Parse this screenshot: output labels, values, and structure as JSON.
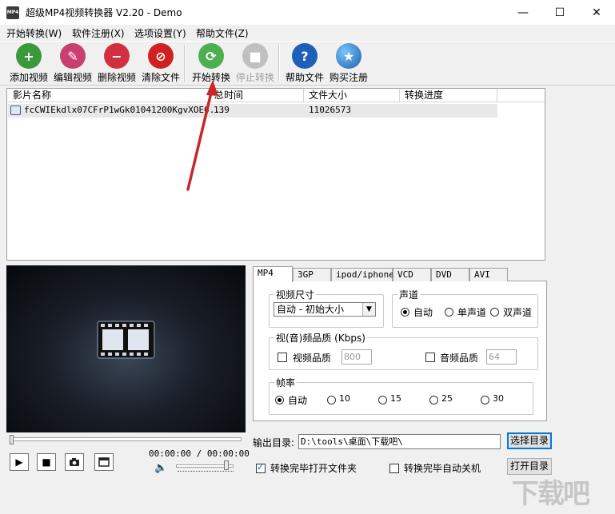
{
  "window": {
    "app_icon_text": "MP4",
    "title": "超级MP4视频转换器 V2.20 - Demo",
    "minimize": "—",
    "maximize": "☐",
    "close": "✕"
  },
  "menu": [
    "开始转换(W)",
    "软件注册(X)",
    "选项设置(Y)",
    "帮助文件(Z)"
  ],
  "toolbar": [
    {
      "label": "添加视频",
      "icon": "add-video-icon",
      "color": "#3a9a3a"
    },
    {
      "label": "编辑视频",
      "icon": "edit-video-icon",
      "color": "#c94070"
    },
    {
      "label": "删除视频",
      "icon": "delete-video-icon",
      "color": "#d03040"
    },
    {
      "label": "清除文件",
      "icon": "clear-files-icon",
      "color": "#d02020"
    },
    {
      "label": "开始转换",
      "icon": "start-convert-icon",
      "color": "#4caf50"
    },
    {
      "label": "停止转换",
      "icon": "stop-convert-icon",
      "color": "#b8b8b8",
      "disabled": true
    },
    {
      "label": "帮助文件",
      "icon": "help-icon",
      "color": "#1e5fb8"
    },
    {
      "label": "购买注册",
      "icon": "buy-register-icon",
      "color": "#2a7fd0"
    }
  ],
  "file_list": {
    "columns": [
      "影片名称",
      "总时间",
      "文件大小",
      "转换进度"
    ],
    "rows": [
      {
        "name": "fcCWIEkdlx07CFrP1wGk01041200KgvXOE0...",
        "duration": "139",
        "size": "11026573",
        "progress": ""
      }
    ]
  },
  "player": {
    "timecode": "00:00:00 / 00:00:00",
    "play": "▶",
    "stop": "■",
    "snapshot": "📷",
    "fullscreen": "▭",
    "speaker": "🔈"
  },
  "tabs": [
    "MP4",
    "3GP",
    "ipod/iphone",
    "VCD",
    "DVD",
    "AVI"
  ],
  "settings": {
    "video_size_label": "视频尺寸",
    "video_size_value": "自动 - 初始大小",
    "audio_channel_label": "声道",
    "channel_options": [
      "自动",
      "单声道",
      "双声道"
    ],
    "quality_label": "视(音)频品质 (Kbps)",
    "video_quality_label": "视频品质",
    "video_quality_value": "800",
    "audio_quality_label": "音频品质",
    "audio_quality_value": "64",
    "framerate_label": "帧率",
    "framerate_options": [
      "自动",
      "10",
      "15",
      "25",
      "30"
    ]
  },
  "output": {
    "label": "输出目录:",
    "path": "D:\\tools\\桌面\\下载吧\\",
    "browse": "选择目录",
    "open": "打开目录",
    "open_folder_after": "转换完毕打开文件夹",
    "shutdown_after": "转换完毕自动关机"
  },
  "watermark": "下载吧"
}
